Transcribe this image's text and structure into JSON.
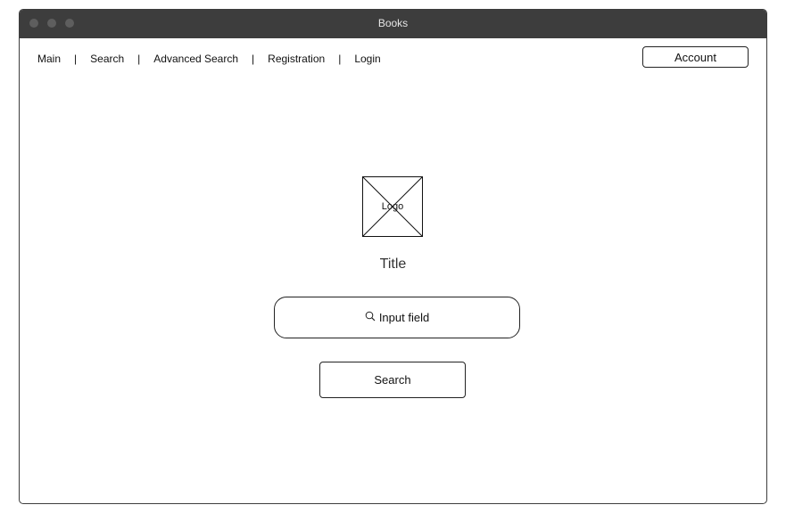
{
  "window": {
    "title": "Books"
  },
  "nav": {
    "items": [
      "Main",
      "Search",
      "Advanced Search",
      "Registration",
      "Login"
    ],
    "separator": "|"
  },
  "header": {
    "account_label": "Account"
  },
  "main": {
    "logo_label": "Logo",
    "title": "Title",
    "search_input": {
      "placeholder": "Input field",
      "icon": "search-icon"
    },
    "search_button_label": "Search"
  }
}
